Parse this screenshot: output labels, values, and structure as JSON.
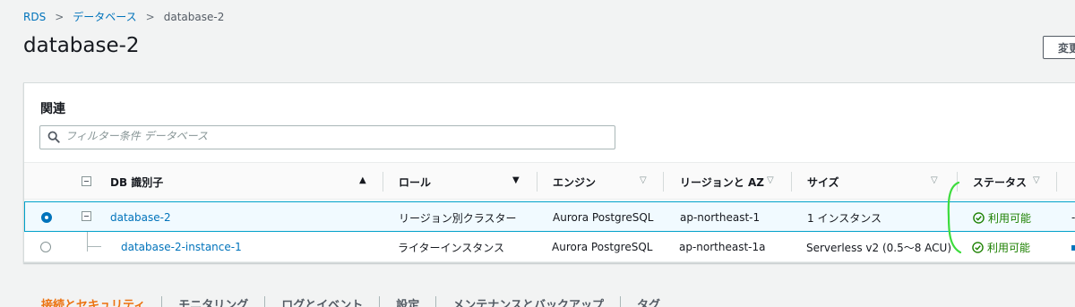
{
  "breadcrumb": {
    "items": [
      "RDS",
      "データベース"
    ],
    "current": "database-2"
  },
  "page": {
    "title": "database-2",
    "modify_label": "変更"
  },
  "panel": {
    "title": "関連",
    "search_placeholder": "フィルター条件 データベース"
  },
  "table": {
    "columns": [
      "DB 識別子",
      "ロール",
      "エンジン",
      "リージョンと AZ",
      "サイズ",
      "ステータス"
    ],
    "rows": [
      {
        "identifier": "database-2",
        "role": "リージョン別クラスター",
        "engine": "Aurora PostgreSQL",
        "region": "ap-northeast-1",
        "size": "1 インスタンス",
        "status": "利用可能",
        "extra": "-",
        "selected": true
      },
      {
        "identifier": "database-2-instance-1",
        "role": "ライターインスタンス",
        "engine": "Aurora PostgreSQL",
        "region": "ap-northeast-1a",
        "size": "Serverless v2 (0.5〜8 ACU)",
        "status": "利用可能",
        "selected": false
      }
    ]
  },
  "tabs": [
    "接続とセキュリティ",
    "モニタリング",
    "ログとイベント",
    "設定",
    "メンテナンスとバックアップ",
    "タグ"
  ],
  "colors": {
    "link": "#0073bb",
    "status_ok": "#1d8102",
    "active_tab": "#ec7211",
    "annotation": "#3ddc3d"
  }
}
